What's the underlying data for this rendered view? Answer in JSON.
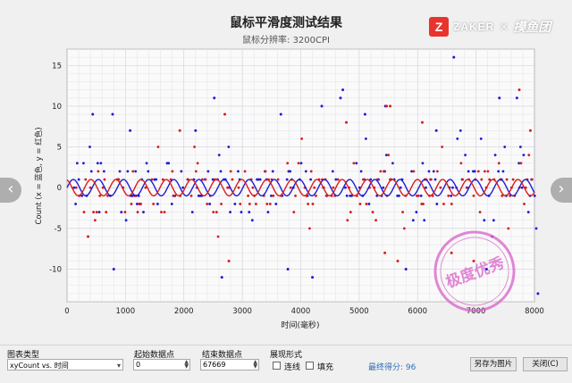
{
  "header": {
    "title": "鼠标平滑度测试结果",
    "subtitle": "鼠标分辨率: 3200CPI"
  },
  "brand": {
    "name": "ZAKER",
    "letter": "Z",
    "cross": "×",
    "partner": "摸鱼团"
  },
  "chart_data": {
    "type": "scatter",
    "xlabel": "时间(毫秒)",
    "ylabel": "Count (x = 蓝色, y = 红色)",
    "xlim": [
      0,
      8000
    ],
    "ylim": [
      -14,
      17
    ],
    "xticks": [
      0,
      1000,
      2000,
      3000,
      4000,
      5000,
      6000,
      7000,
      8000
    ],
    "yticks": [
      15,
      10,
      5,
      0,
      -5,
      -10
    ],
    "grid": true,
    "series": [
      {
        "name": "x",
        "color": "#1c1cd8",
        "line_period_ms": 430,
        "line_amplitude": 1,
        "outliers": [
          [
            6620,
            16
          ],
          [
            4720,
            12
          ],
          [
            4680,
            11
          ],
          [
            2520,
            11
          ],
          [
            5450,
            10
          ],
          [
            4360,
            10
          ],
          [
            780,
            9
          ],
          [
            440,
            9
          ],
          [
            3660,
            9
          ],
          [
            5100,
            9
          ],
          [
            7400,
            11
          ],
          [
            7700,
            11
          ],
          [
            800,
            -10
          ],
          [
            2650,
            -11
          ],
          [
            4200,
            -11
          ],
          [
            5800,
            -10
          ],
          [
            7180,
            -10
          ],
          [
            8060,
            -13
          ],
          [
            3780,
            -10
          ],
          [
            1080,
            7
          ],
          [
            2200,
            7
          ],
          [
            6320,
            7
          ]
        ]
      },
      {
        "name": "y",
        "color": "#d81c1c",
        "line_period_ms": 430,
        "line_amplitude": 1,
        "outliers": [
          [
            7740,
            12
          ],
          [
            5470,
            10
          ],
          [
            5530,
            10
          ],
          [
            2700,
            9
          ],
          [
            4780,
            8
          ],
          [
            6080,
            8
          ],
          [
            1930,
            7
          ],
          [
            7930,
            7
          ],
          [
            5660,
            -9
          ],
          [
            6580,
            -8
          ],
          [
            5440,
            -8
          ],
          [
            2770,
            -9
          ],
          [
            360,
            -6
          ],
          [
            6960,
            -9
          ]
        ]
      }
    ]
  },
  "nav": {
    "prev": "‹",
    "next": "›"
  },
  "controls": {
    "chart_type_label": "图表类型",
    "chart_type_value": "xyCount vs. 时间",
    "start_label": "起始数据点",
    "start_value": "0",
    "end_label": "结束数据点",
    "end_value": "67669",
    "display_label": "展现形式",
    "line_label": "连线",
    "fill_label": "填充",
    "score_text": "最终得分: 96",
    "save_label": "另存为图片",
    "close_label": "关闭(C)"
  },
  "stamp": {
    "text": "极度优秀",
    "color": "#d860c8"
  }
}
